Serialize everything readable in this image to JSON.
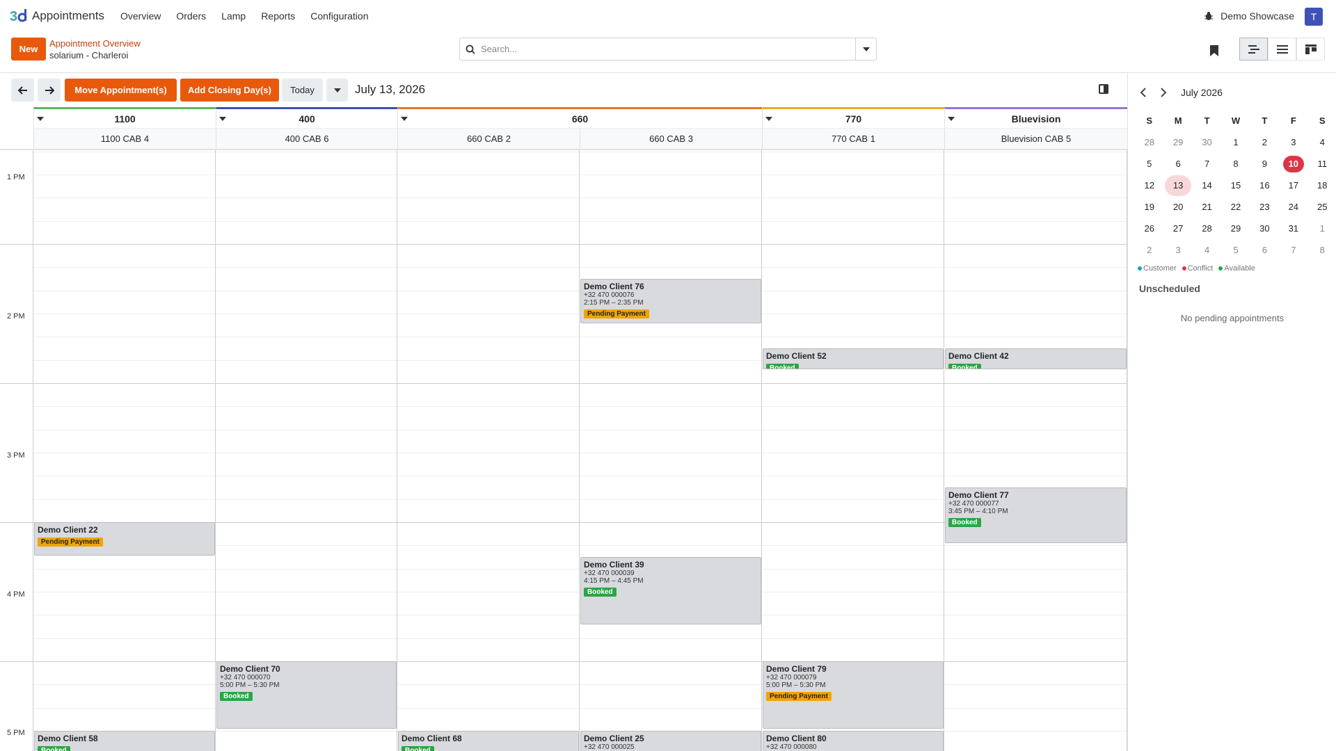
{
  "app": {
    "name": "Appointments",
    "logo_icon": "odoo-logo-icon"
  },
  "nav": {
    "items": [
      "Overview",
      "Orders",
      "Lamp",
      "Reports",
      "Configuration"
    ]
  },
  "user": {
    "company": "Demo Showcase",
    "avatar_letter": "T",
    "avatar_color": "#3f51b5"
  },
  "control": {
    "new_label": "New",
    "breadcrumb": "Appointment Overview",
    "sub": "solarium - Charleroi",
    "search_placeholder": "Search..."
  },
  "toolbar": {
    "move_label": "Move Appointment(s)",
    "closing_label": "Add Closing Day(s)",
    "today_label": "Today",
    "date_title": "July 13, 2026",
    "accent": "#e8590c"
  },
  "groups": [
    {
      "name": "1100",
      "color": "#5cb85c"
    },
    {
      "name": "400",
      "color": "#3a4fb5"
    },
    {
      "name": "660",
      "color": "#e87722"
    },
    {
      "name": "770",
      "color": "#e8b019"
    },
    {
      "name": "Bluevision",
      "color": "#9b72d8"
    }
  ],
  "resources": [
    "1100 CAB 4",
    "400 CAB 6",
    "660 CAB 2",
    "660 CAB 3",
    "770 CAB 1",
    "Bluevision CAB 5"
  ],
  "hours": [
    "1 PM",
    "2 PM",
    "3 PM",
    "4 PM",
    "5 PM"
  ],
  "appointments": [
    {
      "name": "Demo Client 76",
      "phone": "+32 470 000076",
      "time": "2:15 PM – 2:35 PM",
      "status": "Pending Payment"
    },
    {
      "name": "Demo Client 52",
      "status": "Booked"
    },
    {
      "name": "Demo Client 42",
      "status": "Booked"
    },
    {
      "name": "Demo Client 77",
      "phone": "+32 470 000077",
      "time": "3:45 PM – 4:10 PM",
      "status": "Booked"
    },
    {
      "name": "Demo Client 22",
      "status": "Pending Payment"
    },
    {
      "name": "Demo Client 39",
      "phone": "+32 470 000039",
      "time": "4:15 PM – 4:45 PM",
      "status": "Booked"
    },
    {
      "name": "Demo Client 70",
      "phone": "+32 470 000070",
      "time": "5:00 PM – 5:30 PM",
      "status": "Booked"
    },
    {
      "name": "Demo Client 79",
      "phone": "+32 470 000079",
      "time": "5:00 PM – 5:30 PM",
      "status": "Pending Payment"
    },
    {
      "name": "Demo Client 58",
      "status": "Booked"
    },
    {
      "name": "Demo Client 68",
      "status": "Booked"
    },
    {
      "name": "Demo Client 25",
      "phone": "+32 470 000025"
    },
    {
      "name": "Demo Client 80",
      "phone": "+32 470 000080"
    }
  ],
  "status_colors": {
    "Booked": "#28a745",
    "Pending Payment": "#f0a500"
  },
  "mini_calendar": {
    "title": "July 2026",
    "weekdays": [
      "S",
      "M",
      "T",
      "W",
      "T",
      "F",
      "S"
    ],
    "weeks": [
      [
        "28",
        "29",
        "30",
        "1",
        "2",
        "3",
        "4"
      ],
      [
        "5",
        "6",
        "7",
        "8",
        "9",
        "10",
        "11"
      ],
      [
        "12",
        "13",
        "14",
        "15",
        "16",
        "17",
        "18"
      ],
      [
        "19",
        "20",
        "21",
        "22",
        "23",
        "24",
        "25"
      ],
      [
        "26",
        "27",
        "28",
        "29",
        "30",
        "31",
        "1"
      ],
      [
        "2",
        "3",
        "4",
        "5",
        "6",
        "7",
        "8"
      ]
    ],
    "today": "10",
    "selected": "13"
  },
  "legend": [
    {
      "label": "Customer",
      "color": "#17a2b8"
    },
    {
      "label": "Conflict",
      "color": "#dc3545"
    },
    {
      "label": "Available",
      "color": "#28a745"
    }
  ],
  "unscheduled": {
    "title": "Unscheduled",
    "empty": "No pending appointments"
  }
}
